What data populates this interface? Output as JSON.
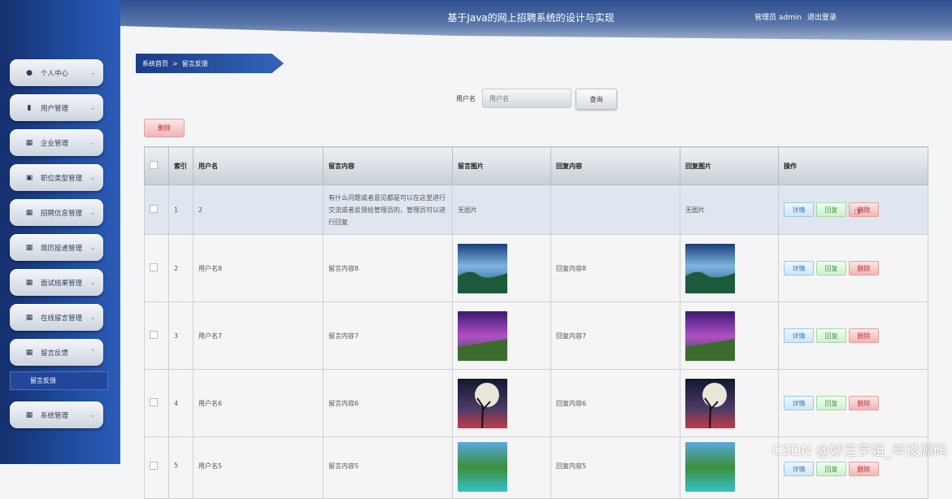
{
  "header": {
    "title": "基于Java的网上招聘系统的设计与实现",
    "user_label": "管理员 admin",
    "logout": "退出登录"
  },
  "sidebar": {
    "items": [
      {
        "label": "个人中心",
        "icon": "person-icon",
        "expanded": false
      },
      {
        "label": "用户管理",
        "icon": "clipboard-icon",
        "expanded": false
      },
      {
        "label": "企业管理",
        "icon": "grid-icon",
        "expanded": false
      },
      {
        "label": "职位类型管理",
        "icon": "briefcase-icon",
        "expanded": false
      },
      {
        "label": "招聘信息管理",
        "icon": "grid-icon",
        "expanded": false
      },
      {
        "label": "简历投递管理",
        "icon": "grid-icon",
        "expanded": false
      },
      {
        "label": "面试结果管理",
        "icon": "grid-icon",
        "expanded": false
      },
      {
        "label": "在线留言管理",
        "icon": "grid-icon",
        "expanded": false
      },
      {
        "label": "留言反馈",
        "icon": "grid-icon",
        "expanded": true
      },
      {
        "label": "系统管理",
        "icon": "grid-icon",
        "expanded": false
      }
    ],
    "submenu": {
      "label": "留言反馈"
    }
  },
  "breadcrumb": {
    "home": "系统首页",
    "separator": ">",
    "current": "留言反馈"
  },
  "search": {
    "label": "用户名",
    "placeholder": "用户名",
    "button": "查询"
  },
  "toolbar": {
    "delete_label": "删除"
  },
  "table": {
    "headers": {
      "index": "索引",
      "username": "用户名",
      "content": "留言内容",
      "image": "留言图片",
      "reply": "回复内容",
      "reply_image": "回复图片",
      "actions": "操作"
    },
    "rows": [
      {
        "index": "1",
        "username": "2",
        "content": "有什么问题或者意见都是可以在这里进行交流或者反馈给管理员的，管理员可以进行回复",
        "image": "无图片",
        "reply": "",
        "reply_image": "无图片"
      },
      {
        "index": "2",
        "username": "用户名8",
        "content": "留言内容8",
        "image": "lake-photo",
        "reply": "回复内容8",
        "reply_image": "lake-photo"
      },
      {
        "index": "3",
        "username": "用户名7",
        "content": "留言内容7",
        "image": "purple-sunset-photo",
        "reply": "回复内容7",
        "reply_image": "purple-sunset-photo"
      },
      {
        "index": "4",
        "username": "用户名6",
        "content": "留言内容6",
        "image": "moon-tree-photo",
        "reply": "回复内容6",
        "reply_image": "moon-tree-photo"
      },
      {
        "index": "5",
        "username": "用户名5",
        "content": "留言内容5",
        "image": "beach-photo",
        "reply": "回复内容5",
        "reply_image": "beach-photo"
      }
    ],
    "actions": {
      "detail": "详情",
      "reply": "回复",
      "delete": "删除"
    }
  },
  "watermark": "CSDN @妙芝学姐_毕设源码"
}
